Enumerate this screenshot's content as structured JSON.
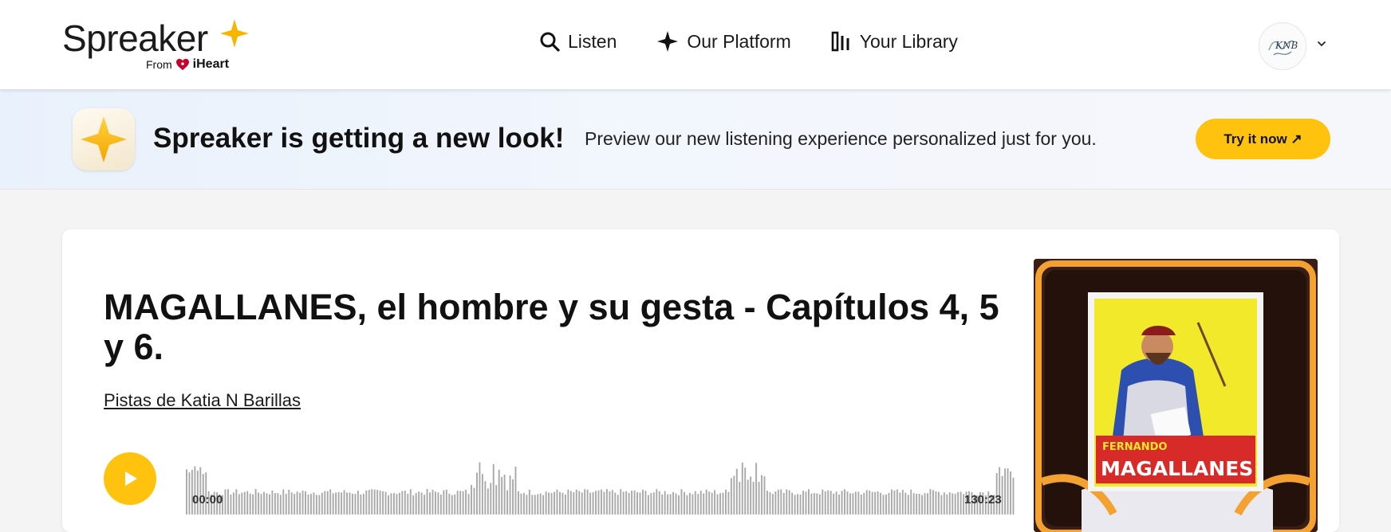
{
  "header": {
    "logo_word": "Spreaker",
    "logo_from": "From",
    "logo_brand": "iHeart",
    "nav": [
      {
        "label": "Listen",
        "icon": "search-icon"
      },
      {
        "label": "Our Platform",
        "icon": "star-icon"
      },
      {
        "label": "Your Library",
        "icon": "library-icon"
      }
    ],
    "avatar_text": "KNB"
  },
  "banner": {
    "title": "Spreaker is getting a new look!",
    "subtitle": "Preview our new listening experience personalized just for you.",
    "cta_label": "Try it now ↗"
  },
  "episode": {
    "title": "MAGALLANES, el hombre y su gesta - Capítulos 4, 5 y 6.",
    "show_link": "Pistas de Katia N Barillas",
    "time_start": "00:00",
    "time_end": "130:23",
    "cover_text_line1": "FERNANDO",
    "cover_text_line2": "MAGALLANES"
  },
  "colors": {
    "accent": "#ffc20e",
    "star": "#f7b500",
    "text": "#111111"
  }
}
